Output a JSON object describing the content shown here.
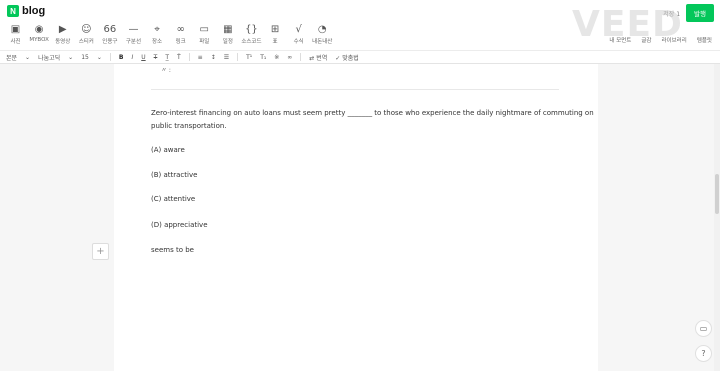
{
  "header": {
    "logo_badge": "N",
    "logo_text": "blog",
    "save_count": "저장 1",
    "publish_label": "발행"
  },
  "watermark": "VEED",
  "toolbar": {
    "tools": [
      {
        "icon": "▣",
        "icon_name": "photo-icon",
        "label": "사진"
      },
      {
        "icon": "◉",
        "icon_name": "mybox-icon",
        "label": "MYBOX"
      },
      {
        "icon": "▶",
        "icon_name": "video-icon",
        "label": "동영상"
      },
      {
        "icon": "☺",
        "icon_name": "sticker-icon",
        "label": "스티커"
      },
      {
        "icon": "66",
        "icon_name": "quote-icon",
        "label": "인용구"
      },
      {
        "icon": "—",
        "icon_name": "divider-icon",
        "label": "구분선"
      },
      {
        "icon": "⌖",
        "icon_name": "place-icon",
        "label": "장소"
      },
      {
        "icon": "∞",
        "icon_name": "link-icon",
        "label": "링크"
      },
      {
        "icon": "▭",
        "icon_name": "file-icon",
        "label": "파일"
      },
      {
        "icon": "▦",
        "icon_name": "schedule-icon",
        "label": "일정"
      },
      {
        "icon": "{}",
        "icon_name": "code-icon",
        "label": "소스코드"
      },
      {
        "icon": "⊞",
        "icon_name": "table-icon",
        "label": "표"
      },
      {
        "icon": "√",
        "icon_name": "formula-icon",
        "label": "수식"
      },
      {
        "icon": "◔",
        "icon_name": "my-content-icon",
        "label": "내돈내산"
      }
    ],
    "right_tools": [
      "내 모먼트",
      "글감",
      "라이브러리",
      "템플릿"
    ]
  },
  "format": {
    "style": "본문",
    "font": "나눔고딕",
    "size": "15",
    "bold": "B",
    "italic": "I",
    "underline": "U",
    "strike": "T",
    "translate": "번역",
    "spellcheck": "맞춤법"
  },
  "document": {
    "question_line1": "Zero-interest financing on auto loans must seem pretty _______ to those who experience the daily nightmare of commuting on",
    "question_line2": "public transportation.",
    "options": [
      "(A) aware",
      "(B) attractive",
      "(C) attentive",
      "(D) appreciative"
    ],
    "note": "seems to be"
  }
}
